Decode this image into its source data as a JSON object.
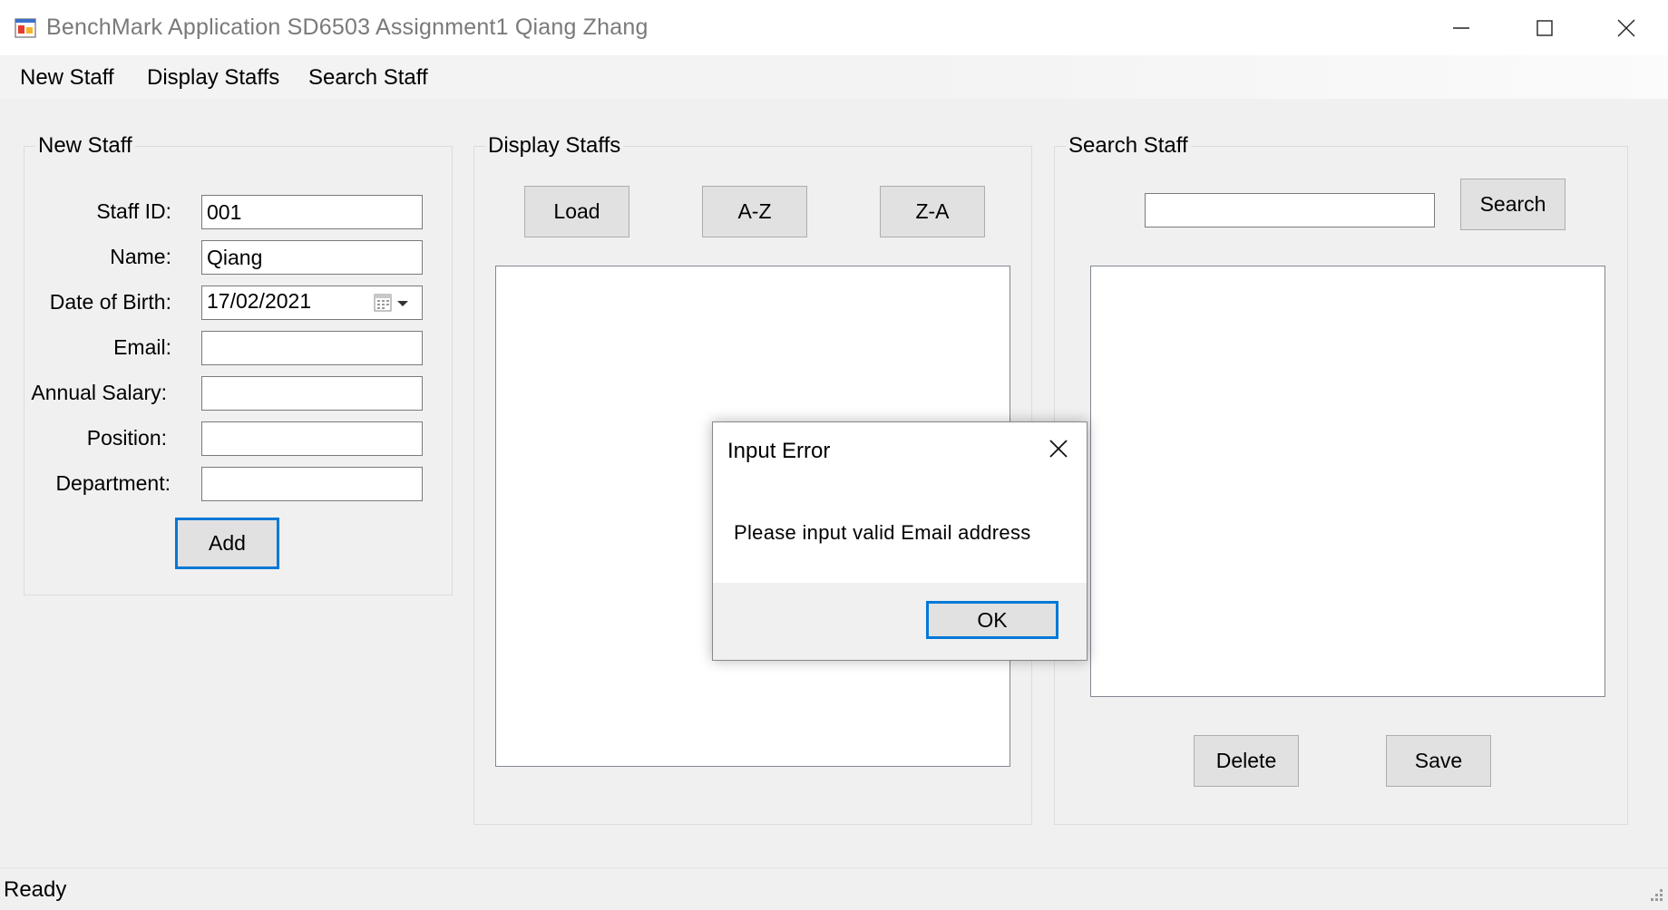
{
  "window": {
    "title": "BenchMark Application SD6503 Assignment1 Qiang Zhang",
    "icon": "app-icon",
    "controls": [
      "minimize-icon",
      "maximize-icon",
      "close-icon"
    ]
  },
  "menu": {
    "items": [
      "New Staff",
      "Display Staffs",
      "Search Staff"
    ]
  },
  "new_staff": {
    "title": "New Staff",
    "staff_id_label": "Staff ID:",
    "staff_id_value": "001",
    "name_label": "Name:",
    "name_value": "Qiang",
    "dob_label": "Date of Birth:",
    "dob_value": "17/02/2021",
    "email_label": "Email:",
    "email_value": "",
    "salary_label": "Annual Salary:",
    "salary_value": "",
    "position_label": "Position:",
    "position_value": "",
    "department_label": "Department:",
    "department_value": "",
    "add_button": "Add"
  },
  "display_staffs": {
    "title": "Display Staffs",
    "load_button": "Load",
    "az_button": "A-Z",
    "za_button": "Z-A"
  },
  "search_staff": {
    "title": "Search Staff",
    "search_value": "",
    "search_button": "Search",
    "delete_button": "Delete",
    "save_button": "Save"
  },
  "status": {
    "text": "Ready"
  },
  "dialog": {
    "title": "Input Error",
    "message": "Please input valid Email address",
    "ok_button": "OK"
  },
  "colors": {
    "window_bg": "#f0f0f0",
    "focus_accent": "#0078d7",
    "button_bg": "#e1e1e1"
  }
}
